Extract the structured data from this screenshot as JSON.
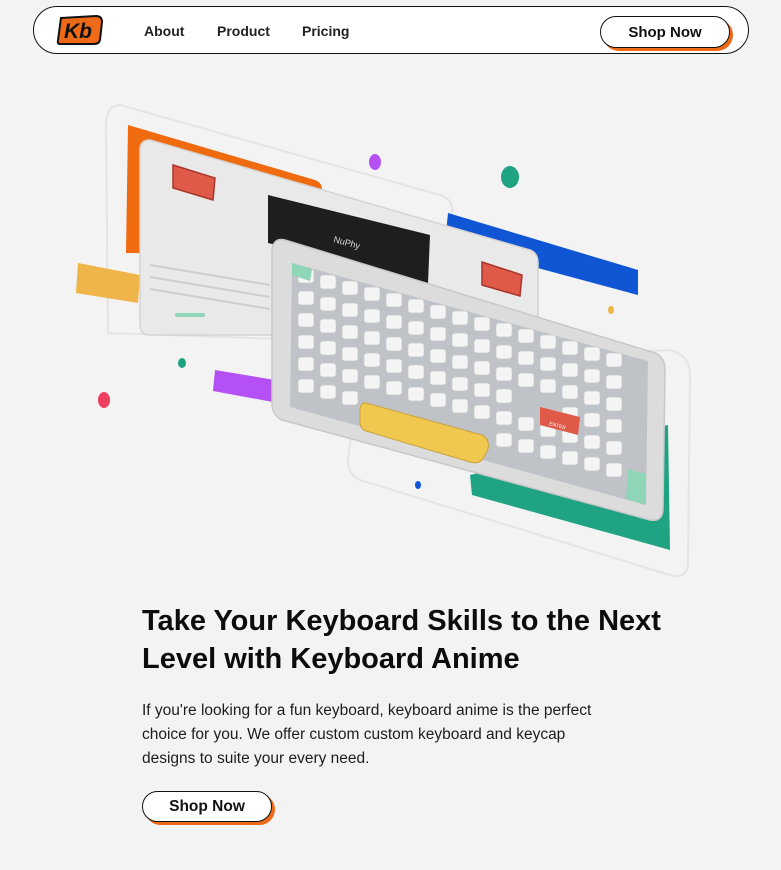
{
  "nav": {
    "logo_text": "Kb",
    "links": [
      {
        "label": "About"
      },
      {
        "label": "Product"
      },
      {
        "label": "Pricing"
      }
    ],
    "cta_label": "Shop Now"
  },
  "hero_image": {
    "brand_text": "NuPhy",
    "enter_key_label": "ENTER"
  },
  "main": {
    "headline": "Take Your Keyboard Skills to the Next Level with Keyboard Anime",
    "description": "If you're looking for a fun keyboard, keyboard anime is the perfect choice for you. We offer custom custom keyboard and keycap designs to suite your every need.",
    "cta_label": "Shop Now"
  },
  "colors": {
    "accent": "#ef6a18",
    "orange_bar": "#f06a0f",
    "blue_bar": "#0f55d4",
    "teal_bar": "#1fa383",
    "purple_bar": "#b550f5",
    "yellow_bar": "#f0b548",
    "spacebar": "#f0c850",
    "enter_key": "#e05a4a",
    "mint_key": "#8fd5b8"
  }
}
